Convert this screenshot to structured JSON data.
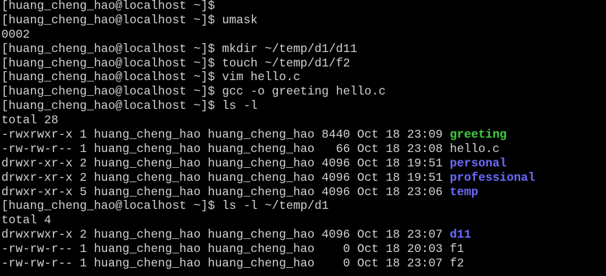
{
  "terminal": {
    "lines": [
      {
        "segments": [
          {
            "text": "[huang_cheng_hao@localhost ~]$",
            "kind": "plain"
          }
        ]
      },
      {
        "segments": [
          {
            "text": "[huang_cheng_hao@localhost ~]$ umask",
            "kind": "plain"
          }
        ]
      },
      {
        "segments": [
          {
            "text": "0002",
            "kind": "plain"
          }
        ]
      },
      {
        "segments": [
          {
            "text": "[huang_cheng_hao@localhost ~]$ mkdir ~/temp/d1/d11",
            "kind": "plain"
          }
        ]
      },
      {
        "segments": [
          {
            "text": "[huang_cheng_hao@localhost ~]$ touch ~/temp/d1/f2",
            "kind": "plain"
          }
        ]
      },
      {
        "segments": [
          {
            "text": "[huang_cheng_hao@localhost ~]$ vim hello.c",
            "kind": "plain"
          }
        ]
      },
      {
        "segments": [
          {
            "text": "[huang_cheng_hao@localhost ~]$ gcc -o greeting hello.c",
            "kind": "plain"
          }
        ]
      },
      {
        "segments": [
          {
            "text": "[huang_cheng_hao@localhost ~]$ ls -l",
            "kind": "plain"
          }
        ]
      },
      {
        "segments": [
          {
            "text": "total 28",
            "kind": "plain"
          }
        ]
      },
      {
        "segments": [
          {
            "text": "-rwxrwxr-x 1 huang_cheng_hao huang_cheng_hao 8440 Oct 18 23:09 ",
            "kind": "plain"
          },
          {
            "text": "greeting",
            "kind": "exe"
          }
        ]
      },
      {
        "segments": [
          {
            "text": "-rw-rw-r-- 1 huang_cheng_hao huang_cheng_hao   66 Oct 18 23:08 hello.c",
            "kind": "plain"
          }
        ]
      },
      {
        "segments": [
          {
            "text": "drwxr-xr-x 2 huang_cheng_hao huang_cheng_hao 4096 Oct 18 19:51 ",
            "kind": "plain"
          },
          {
            "text": "personal",
            "kind": "dir"
          }
        ]
      },
      {
        "segments": [
          {
            "text": "drwxr-xr-x 2 huang_cheng_hao huang_cheng_hao 4096 Oct 18 19:51 ",
            "kind": "plain"
          },
          {
            "text": "professional",
            "kind": "dir"
          }
        ]
      },
      {
        "segments": [
          {
            "text": "drwxr-xr-x 5 huang_cheng_hao huang_cheng_hao 4096 Oct 18 23:06 ",
            "kind": "plain"
          },
          {
            "text": "temp",
            "kind": "dir"
          }
        ]
      },
      {
        "segments": [
          {
            "text": "[huang_cheng_hao@localhost ~]$ ls -l ~/temp/d1",
            "kind": "plain"
          }
        ]
      },
      {
        "segments": [
          {
            "text": "total 4",
            "kind": "plain"
          }
        ]
      },
      {
        "segments": [
          {
            "text": "drwxrwxr-x 2 huang_cheng_hao huang_cheng_hao 4096 Oct 18 23:07 ",
            "kind": "plain"
          },
          {
            "text": "d11",
            "kind": "dir"
          }
        ]
      },
      {
        "segments": [
          {
            "text": "-rw-rw-r-- 1 huang_cheng_hao huang_cheng_hao    0 Oct 18 20:03 f1",
            "kind": "plain"
          }
        ]
      },
      {
        "segments": [
          {
            "text": "-rw-rw-r-- 1 huang_cheng_hao huang_cheng_hao    0 Oct 18 23:07 f2",
            "kind": "plain"
          }
        ]
      }
    ],
    "colors": {
      "background": "#000000",
      "foreground": "#d2d2d2",
      "directory": "#6b6bff",
      "executable": "#3fcf3f",
      "cursor": "#2ee52e"
    }
  }
}
